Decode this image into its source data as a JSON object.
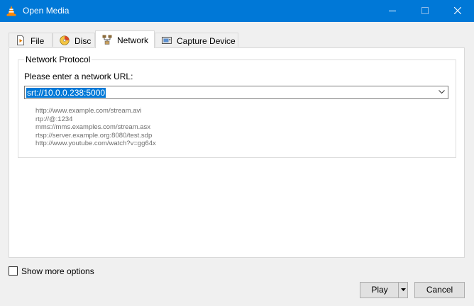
{
  "window": {
    "title": "Open Media",
    "accent": "#0078d7"
  },
  "tabs": [
    {
      "label": "File",
      "icon": "file-icon",
      "active": false
    },
    {
      "label": "Disc",
      "icon": "disc-icon",
      "active": false
    },
    {
      "label": "Network",
      "icon": "network-icon",
      "active": true
    },
    {
      "label": "Capture Device",
      "icon": "capture-device-icon",
      "active": false
    }
  ],
  "network": {
    "group_title": "Network Protocol",
    "prompt": "Please enter a network URL:",
    "url_value": "srt://10.0.0.238:5000",
    "examples": [
      "http://www.example.com/stream.avi",
      "rtp://@:1234",
      "mms://mms.examples.com/stream.asx",
      "rtsp://server.example.org:8080/test.sdp",
      "http://www.youtube.com/watch?v=gg64x"
    ]
  },
  "options": {
    "show_more_label": "Show more options",
    "show_more_checked": false
  },
  "buttons": {
    "play": "Play",
    "cancel": "Cancel"
  }
}
